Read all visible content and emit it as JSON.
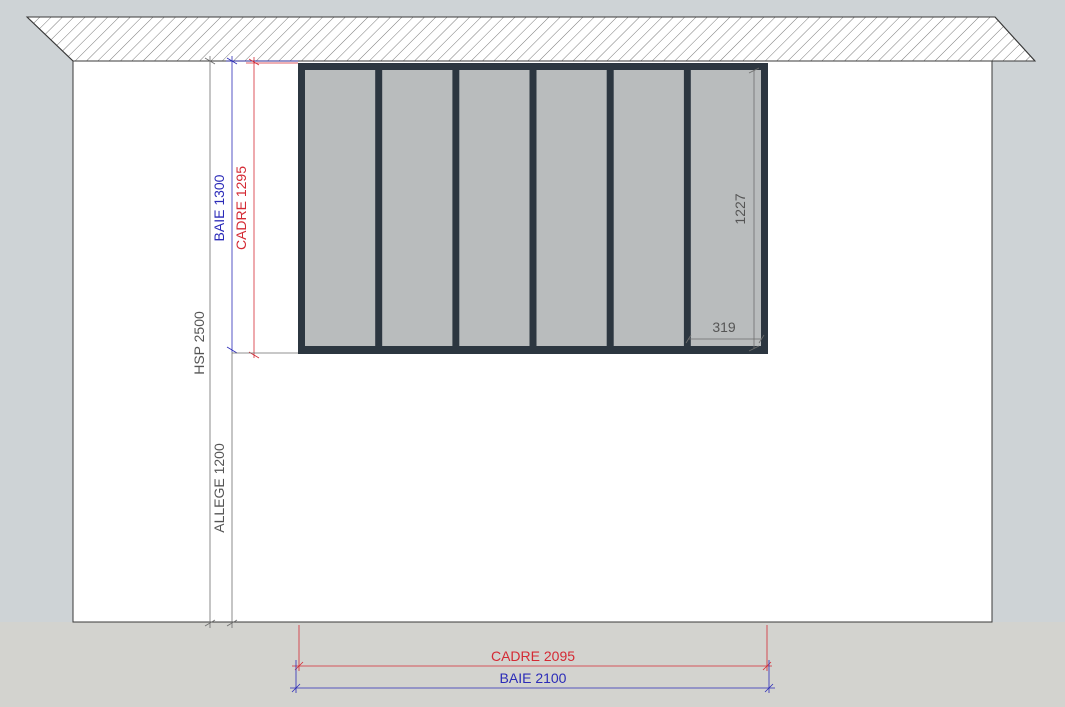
{
  "labels": {
    "hsp": "HSP 2500",
    "allege": "ALLEGE 1200",
    "baie_height": "BAIE 1300",
    "cadre_height": "CADRE 1295",
    "pane_height": "1227",
    "pane_width": "319",
    "cadre_width": "CADRE 2095",
    "baie_width": "BAIE 2100"
  },
  "window": {
    "panels": 6
  },
  "colors": {
    "background": "#ced3d6",
    "ground": "#d3d3cf",
    "wall": "#ffffff",
    "frame": "#2c3640",
    "glass": "#b9bcbd",
    "baie": "#2b2bb8",
    "cadre": "#d42a34",
    "neutral": "#6e6e6e"
  }
}
